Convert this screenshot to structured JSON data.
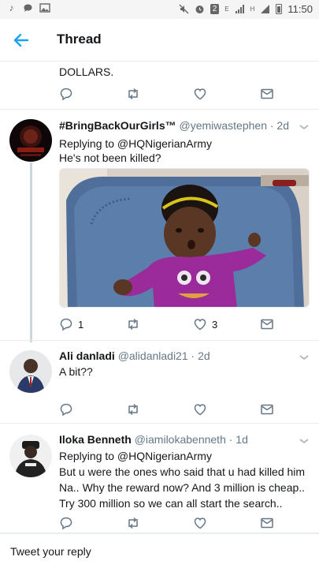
{
  "status_bar": {
    "time": "11:50",
    "sim_badge": "2",
    "network_label": "E",
    "network_label_2": "H"
  },
  "header": {
    "title": "Thread",
    "back_icon": "arrow-left-icon"
  },
  "prev_tweet": {
    "text_tail": "DOLLARS."
  },
  "tweets": [
    {
      "name": "#BringBackOurGirls™",
      "handle": "@yemiwastephen · 2d",
      "reply_to": "Replying to @HQNigerianArmy",
      "text": "He's not been killed?",
      "replies": "1",
      "likes": "3"
    },
    {
      "name": "Ali danladi",
      "handle": "@alidanladi21 · 2d",
      "text": "A bit??"
    },
    {
      "name": "Iloka Benneth",
      "handle": "@iamilokabenneth · 1d",
      "reply_to": "Replying to @HQNigerianArmy",
      "text_lines": [
        "But u were the ones who said that u had killed him",
        "Na.. Why the reward now? And 3 million is cheap..",
        "Try 300 million so we can all start the search.."
      ]
    }
  ],
  "composer": {
    "placeholder": "Tweet your reply"
  },
  "colors": {
    "accent": "#1da1f2",
    "muted": "#657786",
    "divider": "#e6ecf0"
  }
}
